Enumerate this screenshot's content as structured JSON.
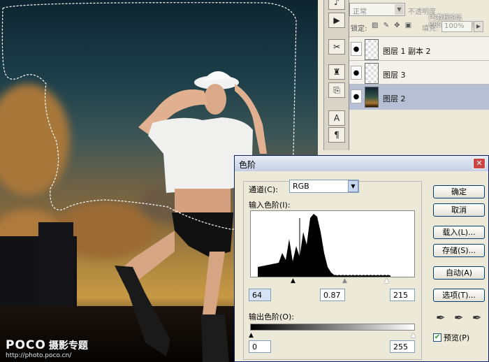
{
  "layers_panel": {
    "blend_mode": "正常",
    "opacity_label": "不透明度",
    "watermark_line1": "PS教程论坛",
    "watermark_line2": "BBS.16XX8.COM",
    "lock_label": "锁定:",
    "fill_label": "填充:",
    "fill_value": "100%",
    "layers": [
      {
        "name": "图层 1 副本 2",
        "selected": false
      },
      {
        "name": "图层 3",
        "selected": false
      },
      {
        "name": "图层 2",
        "selected": true
      }
    ]
  },
  "levels_dialog": {
    "title": "色阶",
    "channel_label": "通道(C):",
    "channel_value": "RGB",
    "input_levels_label": "输入色阶(I):",
    "input_black": "64",
    "input_gamma": "0.87",
    "input_white": "215",
    "output_levels_label": "输出色阶(O):",
    "output_black": "0",
    "output_white": "255",
    "buttons": {
      "ok": "确定",
      "cancel": "取消",
      "load": "载入(L)...",
      "save": "存储(S)...",
      "auto": "自动(A)",
      "options": "选项(T)..."
    },
    "preview_label": "预览(P)",
    "preview_checked": true
  },
  "canvas_watermark": {
    "logo": "POCO",
    "tagline": "摄影专题",
    "url": "http://photo.poco.cn/"
  },
  "icons": [
    "eye-icon",
    "close-icon",
    "eyedropper-black-icon",
    "eyedropper-gray-icon",
    "eyedropper-white-icon",
    "lock-icon"
  ]
}
